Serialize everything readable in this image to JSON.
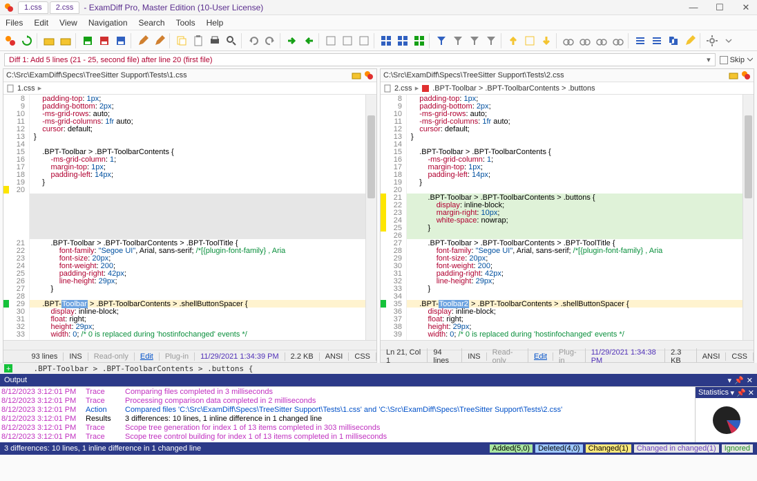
{
  "window": {
    "tab1": "1.css",
    "tab2": "2.css",
    "title": " - ExamDiff Pro, Master Edition (10-User License)"
  },
  "menu": [
    "Files",
    "Edit",
    "View",
    "Navigation",
    "Search",
    "Tools",
    "Help"
  ],
  "diffbar": {
    "text": "Diff 1: Add 5 lines (21 - 25, second file) after line 20 (first file)",
    "skip": "Skip"
  },
  "left": {
    "path": "C:\\Src\\ExamDiff\\Specs\\TreeSitter Support\\Tests\\1.css",
    "crumb1": "1.css",
    "sep": "▸",
    "status": {
      "lines": "93 lines",
      "ins": "INS",
      "ro": "Read-only",
      "edit": "Edit",
      "plugin": "Plug-in",
      "ts": "11/29/2021 1:34:39 PM",
      "size": "2.2 KB",
      "enc": "ANSI",
      "lang": "CSS"
    }
  },
  "right": {
    "path": "C:\\Src\\ExamDiff\\Specs\\TreeSitter Support\\Tests\\2.css",
    "crumb1": "2.css",
    "crumb2": ".BPT-Toolbar > .BPT-ToolbarContents > .buttons",
    "status": {
      "pos": "Ln 21, Col 1",
      "lines": "94 lines",
      "ins": "INS",
      "ro": "Read-only",
      "edit": "Edit",
      "plugin": "Plug-in",
      "ts": "11/29/2021 1:34:38 PM",
      "size": "2.3 KB",
      "enc": "ANSI",
      "lang": "CSS"
    }
  },
  "midline": "    .BPT-Toolbar > .BPT-ToolbarContents > .buttons {",
  "output": {
    "title": "Output",
    "stats": "Statistics",
    "rows": [
      {
        "ts": "8/12/2023 3:12:01 PM",
        "kind": "Trace",
        "cls": "trace",
        "msg": "Comparing files completed in 3 milliseconds"
      },
      {
        "ts": "8/12/2023 3:12:01 PM",
        "kind": "Trace",
        "cls": "trace",
        "msg": "Processing comparison data completed in 2 milliseconds"
      },
      {
        "ts": "8/12/2023 3:12:01 PM",
        "kind": "Action",
        "cls": "action",
        "msg": "Compared files 'C:\\Src\\ExamDiff\\Specs\\TreeSitter Support\\Tests\\1.css' and 'C:\\Src\\ExamDiff\\Specs\\TreeSitter Support\\Tests\\2.css'"
      },
      {
        "ts": "8/12/2023 3:12:01 PM",
        "kind": "Results",
        "cls": "results",
        "msg": "3 differences: 10 lines, 1 inline difference in 1 changed line"
      },
      {
        "ts": "8/12/2023 3:12:01 PM",
        "kind": "Trace",
        "cls": "trace",
        "msg": "Scope tree generation for index 1 of 13 items completed in 303 milliseconds"
      },
      {
        "ts": "8/12/2023 3:12:01 PM",
        "kind": "Trace",
        "cls": "trace",
        "msg": "Scope tree control building for index 1 of 13 items completed in 1 milliseconds"
      }
    ]
  },
  "statusbar": {
    "text": "3 differences: 10 lines, 1 inline difference in 1 changed line",
    "legend": {
      "added": "Added(5,0)",
      "deleted": "Deleted(4,0)",
      "changed": "Changed(1)",
      "cic": "Changed in changed(1)",
      "ign": "Ignored"
    }
  },
  "left_code": [
    {
      "n": "8",
      "h": "    <span class='tok-kw'>padding-top</span>: <span class='tok-num'>1px</span>;"
    },
    {
      "n": "9",
      "h": "    <span class='tok-kw'>padding-bottom</span>: <span class='tok-num'>2px</span>;"
    },
    {
      "n": "10",
      "h": "    <span class='tok-kw'>-ms-grid-rows</span>: auto;"
    },
    {
      "n": "11",
      "h": "    <span class='tok-kw'>-ms-grid-columns</span>: <span class='tok-num'>1fr</span> auto;"
    },
    {
      "n": "12",
      "h": "    <span class='tok-kw'>cursor</span>: default;"
    },
    {
      "n": "13",
      "h": "}"
    },
    {
      "n": "14",
      "h": ""
    },
    {
      "n": "15",
      "h": "    .BPT-Toolbar &gt; .BPT-ToolbarContents {"
    },
    {
      "n": "16",
      "h": "        <span class='tok-kw'>-ms-grid-column</span>: <span class='tok-num'>1</span>;"
    },
    {
      "n": "17",
      "h": "        <span class='tok-kw'>margin-top</span>: <span class='tok-num'>1px</span>;"
    },
    {
      "n": "18",
      "h": "        <span class='tok-kw'>padding-left</span>: <span class='tok-num'>14px</span>;"
    },
    {
      "n": "19",
      "h": "    }"
    },
    {
      "n": "20",
      "h": "",
      "mk": "y"
    },
    {
      "n": "",
      "h": "",
      "cls": "ln-gap"
    },
    {
      "n": "",
      "h": "",
      "cls": "ln-gap"
    },
    {
      "n": "",
      "h": "",
      "cls": "ln-gap"
    },
    {
      "n": "",
      "h": "",
      "cls": "ln-gap"
    },
    {
      "n": "",
      "h": "",
      "cls": "ln-gap"
    },
    {
      "n": "",
      "h": "",
      "cls": "ln-gap"
    },
    {
      "n": "21",
      "h": "        .BPT-Toolbar &gt; .BPT-ToolbarContents &gt; .BPT-ToolTitle {"
    },
    {
      "n": "22",
      "h": "            <span class='tok-kw'>font-family</span>: <span class='tok-str'>\"Segoe UI\"</span>, Arial, sans-serif; <span class='tok-cmt'>/*[{plugin-font-family} , Aria</span>"
    },
    {
      "n": "23",
      "h": "            <span class='tok-kw'>font-size</span>: <span class='tok-num'>20px</span>;"
    },
    {
      "n": "24",
      "h": "            <span class='tok-kw'>font-weight</span>: <span class='tok-num'>200</span>;"
    },
    {
      "n": "25",
      "h": "            <span class='tok-kw'>padding-right</span>: <span class='tok-num'>42px</span>;"
    },
    {
      "n": "26",
      "h": "            <span class='tok-kw'>line-height</span>: <span class='tok-num'>29px</span>;"
    },
    {
      "n": "27",
      "h": "        }"
    },
    {
      "n": "28",
      "h": ""
    },
    {
      "n": "29",
      "h": "    .BPT-<span class='tok-hl'>Toolbar</span> &gt; .BPT-ToolbarContents &gt; .shellButtonSpacer {",
      "cls": "ln-chg",
      "mk": "g"
    },
    {
      "n": "30",
      "h": "        <span class='tok-kw'>display</span>: inline-block;"
    },
    {
      "n": "31",
      "h": "        <span class='tok-kw'>float</span>: right;"
    },
    {
      "n": "32",
      "h": "        <span class='tok-kw'>height</span>: <span class='tok-num'>29px</span>;"
    },
    {
      "n": "33",
      "h": "        <span class='tok-kw'>width</span>: <span class='tok-num'>0</span>; <span class='tok-cmt'>/* 0 is replaced during 'hostinfochanged' events */</span>"
    }
  ],
  "right_code": [
    {
      "n": "8",
      "h": "    <span class='tok-kw'>padding-top</span>: <span class='tok-num'>1px</span>;"
    },
    {
      "n": "9",
      "h": "    <span class='tok-kw'>padding-bottom</span>: <span class='tok-num'>2px</span>;"
    },
    {
      "n": "10",
      "h": "    <span class='tok-kw'>-ms-grid-rows</span>: auto;"
    },
    {
      "n": "11",
      "h": "    <span class='tok-kw'>-ms-grid-columns</span>: <span class='tok-num'>1fr</span> auto;"
    },
    {
      "n": "12",
      "h": "    <span class='tok-kw'>cursor</span>: default;"
    },
    {
      "n": "13",
      "h": "}"
    },
    {
      "n": "14",
      "h": ""
    },
    {
      "n": "15",
      "h": "    .BPT-Toolbar &gt; .BPT-ToolbarContents {"
    },
    {
      "n": "16",
      "h": "        <span class='tok-kw'>-ms-grid-column</span>: <span class='tok-num'>1</span>;"
    },
    {
      "n": "17",
      "h": "        <span class='tok-kw'>margin-top</span>: <span class='tok-num'>1px</span>;"
    },
    {
      "n": "18",
      "h": "        <span class='tok-kw'>padding-left</span>: <span class='tok-num'>14px</span>;"
    },
    {
      "n": "19",
      "h": "    }"
    },
    {
      "n": "20",
      "h": ""
    },
    {
      "n": "21",
      "h": "        .BPT-Toolbar &gt; .BPT-ToolbarContents &gt; .buttons {",
      "cls": "ln-add",
      "mk": "y"
    },
    {
      "n": "22",
      "h": "            <span class='tok-kw'>display</span>: inline-block;",
      "cls": "ln-add",
      "mk": "y"
    },
    {
      "n": "23",
      "h": "            <span class='tok-kw'>margin-right</span>: <span class='tok-num'>10px</span>;",
      "cls": "ln-add",
      "mk": "y"
    },
    {
      "n": "24",
      "h": "            <span class='tok-kw'>white-space</span>: nowrap;",
      "cls": "ln-add",
      "mk": "y"
    },
    {
      "n": "25",
      "h": "        }",
      "cls": "ln-add",
      "mk": "y"
    },
    {
      "n": "26",
      "h": "",
      "cls": "ln-add"
    },
    {
      "n": "27",
      "h": "        .BPT-Toolbar &gt; .BPT-ToolbarContents &gt; .BPT-ToolTitle {"
    },
    {
      "n": "28",
      "h": "            <span class='tok-kw'>font-family</span>: <span class='tok-str'>\"Segoe UI\"</span>, Arial, sans-serif; <span class='tok-cmt'>/*[{plugin-font-family} , Aria</span>"
    },
    {
      "n": "29",
      "h": "            <span class='tok-kw'>font-size</span>: <span class='tok-num'>20px</span>;"
    },
    {
      "n": "30",
      "h": "            <span class='tok-kw'>font-weight</span>: <span class='tok-num'>200</span>;"
    },
    {
      "n": "31",
      "h": "            <span class='tok-kw'>padding-right</span>: <span class='tok-num'>42px</span>;"
    },
    {
      "n": "32",
      "h": "            <span class='tok-kw'>line-height</span>: <span class='tok-num'>29px</span>;"
    },
    {
      "n": "33",
      "h": "        }"
    },
    {
      "n": "34",
      "h": ""
    },
    {
      "n": "35",
      "h": "    .BPT-<span class='tok-hl'>Toolbar2</span> &gt; .BPT-ToolbarContents &gt; .shellButtonSpacer {",
      "cls": "ln-chg",
      "mk": "g"
    },
    {
      "n": "36",
      "h": "        <span class='tok-kw'>display</span>: inline-block;"
    },
    {
      "n": "37",
      "h": "        <span class='tok-kw'>float</span>: right;"
    },
    {
      "n": "38",
      "h": "        <span class='tok-kw'>height</span>: <span class='tok-num'>29px</span>;"
    },
    {
      "n": "39",
      "h": "        <span class='tok-kw'>width</span>: <span class='tok-num'>0</span>; <span class='tok-cmt'>/* 0 is replaced during 'hostinfochanged' events */</span>"
    }
  ]
}
